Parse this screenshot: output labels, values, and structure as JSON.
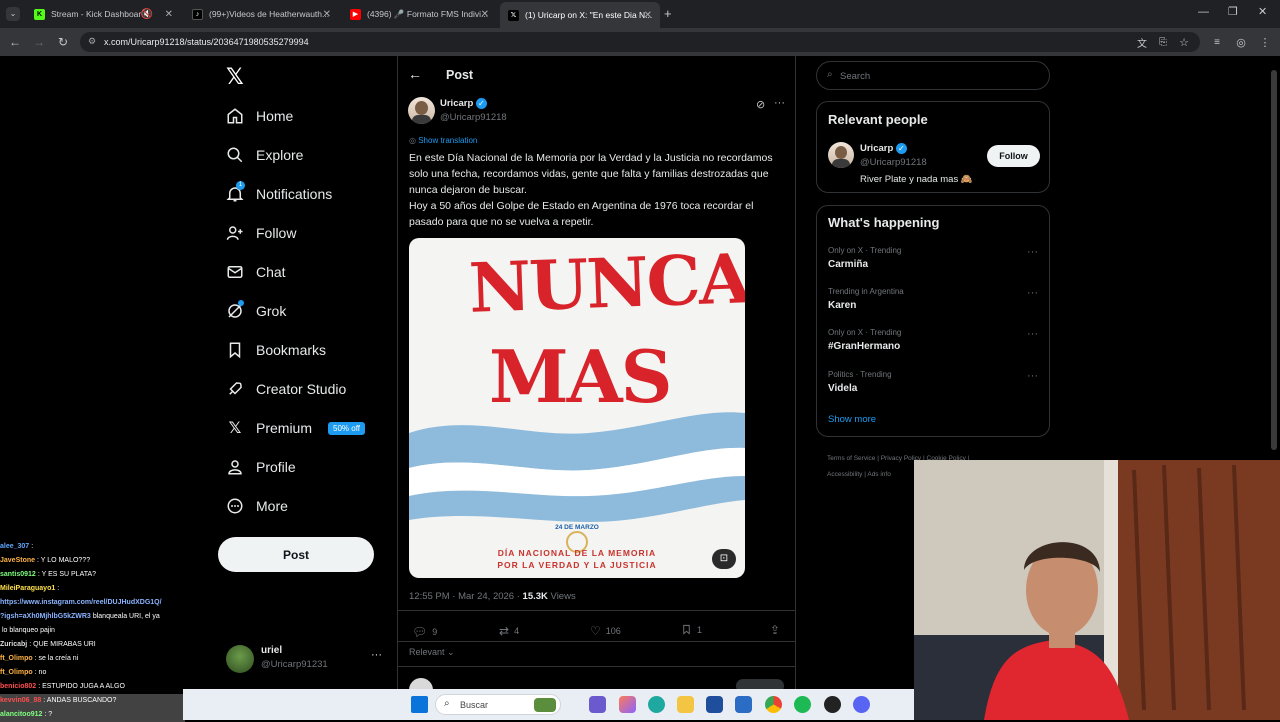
{
  "browser": {
    "tabs": [
      {
        "title": "Stream - Kick Dashboard"
      },
      {
        "title": "(99+)Videos de Heatherwauth..."
      },
      {
        "title": "(4396) 🎤 Formato FMS Indivi..."
      },
      {
        "title": "(1) Uricarp on X: \"En este Dia N..."
      }
    ],
    "url": "x.com/Uricarp91218/status/2036471980535279994"
  },
  "nav": {
    "items": [
      {
        "label": "Home",
        "icon": "home-icon"
      },
      {
        "label": "Explore",
        "icon": "search-icon"
      },
      {
        "label": "Notifications",
        "icon": "bell-icon"
      },
      {
        "label": "Follow",
        "icon": "person-plus-icon"
      },
      {
        "label": "Chat",
        "icon": "mail-icon"
      },
      {
        "label": "Grok",
        "icon": "grok-icon"
      },
      {
        "label": "Bookmarks",
        "icon": "bookmark-icon"
      },
      {
        "label": "Creator Studio",
        "icon": "rocket-icon"
      },
      {
        "label": "Premium",
        "icon": "x-logo-icon"
      },
      {
        "label": "Profile",
        "icon": "person-icon"
      },
      {
        "label": "More",
        "icon": "more-circle-icon"
      }
    ],
    "notification_count": "1",
    "premium_badge": "50% off",
    "post_button": "Post",
    "account": {
      "name": "uriel",
      "handle": "@Uricarp91231"
    }
  },
  "post": {
    "header": "Post",
    "author": {
      "name": "Uricarp",
      "handle": "@Uricarp91218"
    },
    "show_translation": "Show translation",
    "text_p1": "En este Día Nacional de la Memoria por la Verdad y la Justicia no recordamos solo una fecha, recordamos vidas, gente que falta y familias destrozadas que nunca dejaron de buscar.",
    "text_p2": "Hoy a 50 años del Golpe de Estado en Argentina de 1976 toca recordar el pasado para que no se vuelva a repetir.",
    "image": {
      "headline_line1": "NUNCA",
      "headline_line2": "MAS",
      "date": "24 DE MARZO",
      "caption_line1": "DÍA NACIONAL DE LA MEMORIA",
      "caption_line2": "POR LA VERDAD Y LA JUSTICIA"
    },
    "timestamp": "12:55 PM · Mar 24, 2026 ·",
    "views_count": "15.3K",
    "views_label": "Views",
    "replies": "9",
    "reposts": "4",
    "likes": "106",
    "bookmarks": "1",
    "sort": "Relevant"
  },
  "sidebar": {
    "search_placeholder": "Search",
    "relevant_title": "Relevant people",
    "person": {
      "name": "Uricarp",
      "handle": "@Uricarp91218",
      "bio": "River Plate y nada mas 🙈",
      "follow": "Follow"
    },
    "happening_title": "What's happening",
    "trends": [
      {
        "context": "Only on X · Trending",
        "name": "Carmiña"
      },
      {
        "context": "Trending in Argentina",
        "name": "Karen"
      },
      {
        "context": "Only on X · Trending",
        "name": "#GranHermano"
      },
      {
        "context": "Politics · Trending",
        "name": "Videla"
      }
    ],
    "show_more": "Show more",
    "footer": {
      "terms": "Terms of Service",
      "privacy": "Privacy Policy",
      "cookie": "Cookie Policy",
      "accessibility": "Accessibility",
      "ads": "Ads info"
    }
  },
  "chat": [
    {
      "user": "alee_307",
      "msg": ":",
      "color": "#5fa8ff"
    },
    {
      "user": "JaveStone",
      "msg": ": Y LO MALO???",
      "color": "#ffb347"
    },
    {
      "user": "santis0912",
      "msg": ": Y ES SU PLATA?",
      "color": "#7fff7f"
    },
    {
      "user": "MileiParaguayo1",
      "msg": ":",
      "color": "#ffe14d"
    },
    {
      "user": "https://www.instagram.com/reel/DUJHudXDG1Q/",
      "msg": "",
      "color": "#8ab4ff"
    },
    {
      "user": "?igsh=aXh0MjhlbG5kZWR3",
      "msg": "blanqueala URI, el ya",
      "color": "#8ab4ff"
    },
    {
      "user": "",
      "msg": "lo blanqueo pajin",
      "color": "#ffffff"
    },
    {
      "user": "Zuricabj",
      "msg": ": QUE MIRABAS URI",
      "color": "#dddddd"
    },
    {
      "user": "ft_Olimpo",
      "msg": ": se la creía ni",
      "color": "#ffb347"
    },
    {
      "user": "ft_Olimpo",
      "msg": ": no",
      "color": "#ffb347"
    },
    {
      "user": "benicio802",
      "msg": ": ESTUPIDO JUGA A ALGO",
      "color": "#ff4d4d"
    },
    {
      "user": "kevvin06_88",
      "msg": ": ANDAS BUSCANDO?",
      "color": "#ff4d4d"
    },
    {
      "user": "alancitoo912",
      "msg": ": ?",
      "color": "#7fff7f"
    }
  ],
  "taskbar": {
    "search": "Buscar"
  }
}
